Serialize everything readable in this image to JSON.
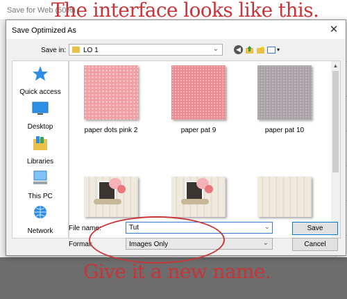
{
  "background_window": {
    "title": "Save for Web (50%)"
  },
  "dialog": {
    "title": "Save Optimized As",
    "close_glyph": "✕",
    "save_in": {
      "label": "Save in:",
      "value": "LO 1",
      "icon": "folder-icon"
    },
    "toolbar": {
      "back_glyph": "◀",
      "view_menu_glyph": "▾"
    },
    "places": [
      {
        "label": "Quick access",
        "icon": "star-icon"
      },
      {
        "label": "Desktop",
        "icon": "desktop-icon"
      },
      {
        "label": "Libraries",
        "icon": "libraries-icon"
      },
      {
        "label": "This PC",
        "icon": "computer-icon"
      },
      {
        "label": "Network",
        "icon": "network-icon"
      }
    ],
    "files": [
      {
        "name": "paper dots pink 2",
        "thumb": "pink-dots"
      },
      {
        "name": "paper pat 9",
        "thumb": "pink-pattern"
      },
      {
        "name": "paper pat 10",
        "thumb": "gray-pattern"
      },
      {
        "name": "",
        "thumb": "wood-layout"
      },
      {
        "name": "",
        "thumb": "wood-layout"
      },
      {
        "name": "",
        "thumb": "wood-plain"
      }
    ],
    "scroll": {
      "up_glyph": "▲",
      "down_glyph": "▼"
    },
    "file_name": {
      "label": "File name:",
      "value": "Tut"
    },
    "format": {
      "label": "Format:",
      "value": "Images Only"
    },
    "buttons": {
      "save": "Save",
      "cancel": "Cancel"
    },
    "dropdown_glyph": "⌄"
  },
  "annotations": {
    "headline": "The interface looks like this.",
    "caption": "Give it a new name.",
    "color": "#c93438"
  }
}
